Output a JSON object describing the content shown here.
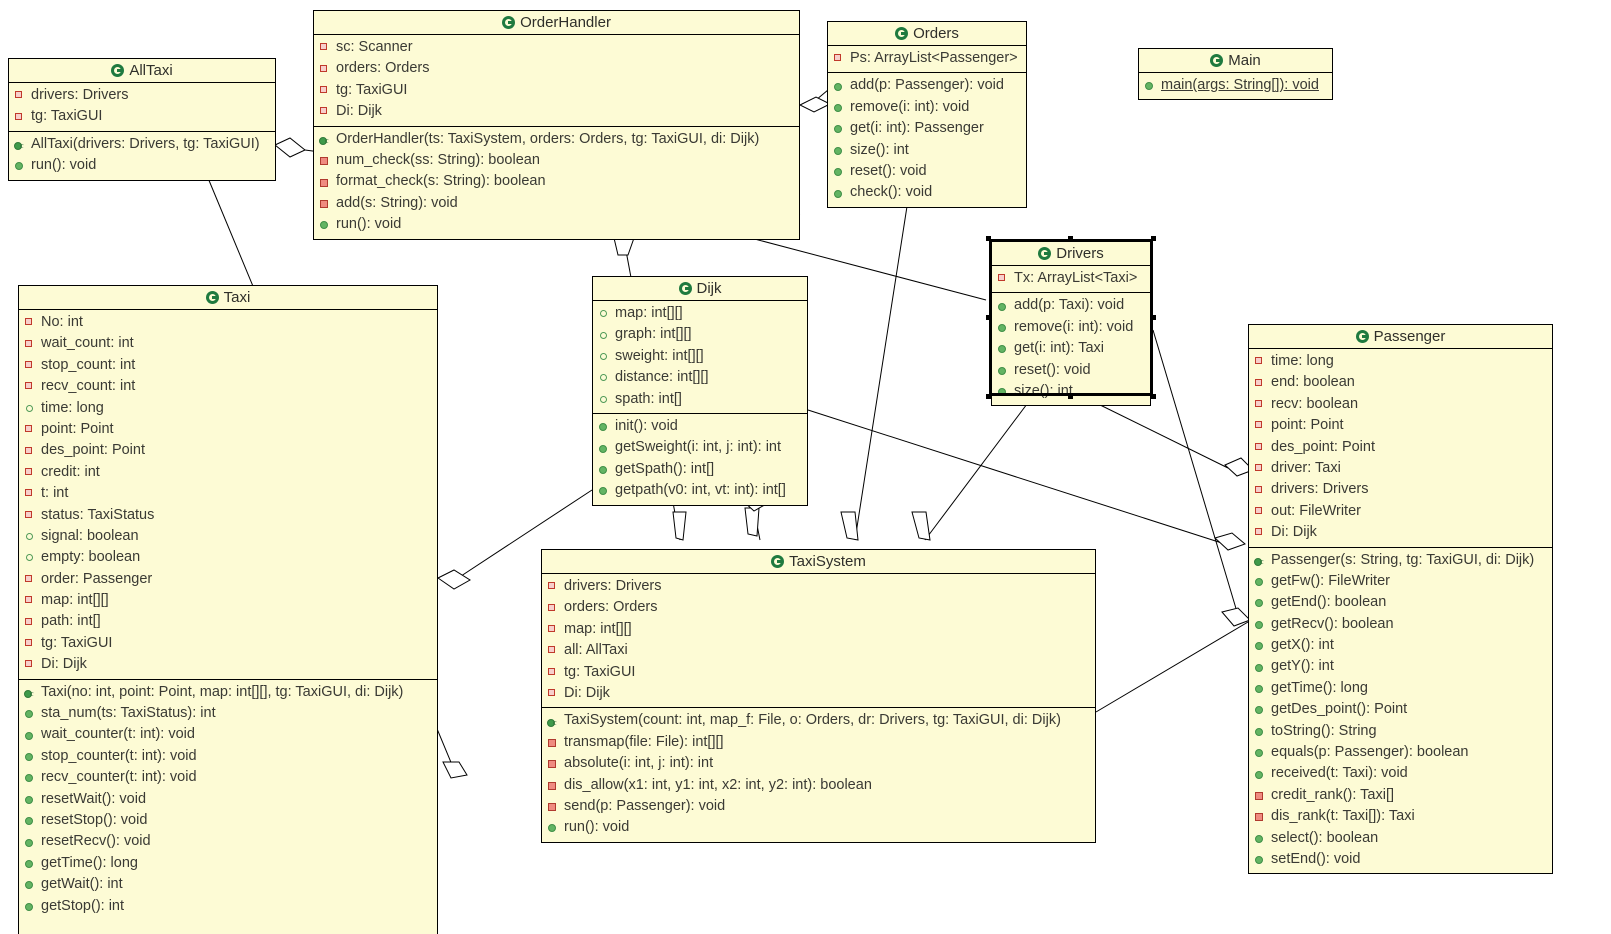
{
  "diagram": {
    "type": "uml-class-diagram",
    "background": "#ffffff",
    "class_fill": "#fdfbd5",
    "border_color": "#000000",
    "icon_color": "#1f7a3f",
    "private_marker_color": "#c0392b",
    "public_marker_color": "#63b463"
  },
  "classes": [
    {
      "id": "alltaxi",
      "name": "AllTaxi",
      "attributes": [
        {
          "text": "drivers: Drivers",
          "vis": "priv"
        },
        {
          "text": "tg: TaxiGUI",
          "vis": "priv"
        }
      ],
      "operations": [
        {
          "text": "AllTaxi(drivers: Drivers, tg: TaxiGUI)",
          "vis": "ctor"
        },
        {
          "text": "run(): void",
          "vis": "pub"
        }
      ]
    },
    {
      "id": "orderhandler",
      "name": "OrderHandler",
      "attributes": [
        {
          "text": "sc: Scanner",
          "vis": "priv"
        },
        {
          "text": "orders: Orders",
          "vis": "priv"
        },
        {
          "text": "tg: TaxiGUI",
          "vis": "priv"
        },
        {
          "text": "Di: Dijk",
          "vis": "priv"
        }
      ],
      "operations": [
        {
          "text": "OrderHandler(ts: TaxiSystem, orders: Orders, tg: TaxiGUI, di: Dijk)",
          "vis": "ctor"
        },
        {
          "text": "num_check(ss: String): boolean",
          "vis": "privm"
        },
        {
          "text": "format_check(s: String): boolean",
          "vis": "privm"
        },
        {
          "text": "add(s: String): void",
          "vis": "privm"
        },
        {
          "text": "run(): void",
          "vis": "pub"
        }
      ]
    },
    {
      "id": "orders",
      "name": "Orders",
      "attributes": [
        {
          "text": "Ps: ArrayList<Passenger>",
          "vis": "priv"
        }
      ],
      "operations": [
        {
          "text": "add(p: Passenger): void",
          "vis": "pub"
        },
        {
          "text": "remove(i: int): void",
          "vis": "pub"
        },
        {
          "text": "get(i: int): Passenger",
          "vis": "pub"
        },
        {
          "text": "size(): int",
          "vis": "pub"
        },
        {
          "text": "reset(): void",
          "vis": "pub"
        },
        {
          "text": "check(): void",
          "vis": "pub"
        }
      ]
    },
    {
      "id": "main",
      "name": "Main",
      "attributes": [],
      "operations": [
        {
          "text": "main(args: String[]): void",
          "vis": "pub",
          "static": true
        }
      ]
    },
    {
      "id": "drivers",
      "name": "Drivers",
      "selected": true,
      "attributes": [
        {
          "text": "Tx: ArrayList<Taxi>",
          "vis": "priv"
        }
      ],
      "operations": [
        {
          "text": "add(p: Taxi): void",
          "vis": "pub"
        },
        {
          "text": "remove(i: int): void",
          "vis": "pub"
        },
        {
          "text": "get(i: int): Taxi",
          "vis": "pub"
        },
        {
          "text": "reset(): void",
          "vis": "pub"
        },
        {
          "text": "size(): int",
          "vis": "pub"
        }
      ]
    },
    {
      "id": "dijk",
      "name": "Dijk",
      "attributes": [
        {
          "text": "map: int[][]",
          "vis": "pkg"
        },
        {
          "text": "graph: int[][]",
          "vis": "pkg"
        },
        {
          "text": "sweight: int[][]",
          "vis": "pkg"
        },
        {
          "text": "distance: int[][]",
          "vis": "pkg"
        },
        {
          "text": "spath: int[]",
          "vis": "pkg"
        }
      ],
      "operations": [
        {
          "text": "init(): void",
          "vis": "pub"
        },
        {
          "text": "getSweight(i: int, j: int): int",
          "vis": "pub"
        },
        {
          "text": "getSpath(): int[]",
          "vis": "pub"
        },
        {
          "text": "getpath(v0: int, vt: int): int[]",
          "vis": "pub"
        }
      ]
    },
    {
      "id": "taxi",
      "name": "Taxi",
      "attributes": [
        {
          "text": "No: int",
          "vis": "priv"
        },
        {
          "text": "wait_count: int",
          "vis": "priv"
        },
        {
          "text": "stop_count: int",
          "vis": "priv"
        },
        {
          "text": "recv_count: int",
          "vis": "priv"
        },
        {
          "text": "time: long",
          "vis": "pkg"
        },
        {
          "text": "point: Point",
          "vis": "priv"
        },
        {
          "text": "des_point: Point",
          "vis": "priv"
        },
        {
          "text": "credit: int",
          "vis": "priv"
        },
        {
          "text": "t: int",
          "vis": "priv"
        },
        {
          "text": "status: TaxiStatus",
          "vis": "priv"
        },
        {
          "text": "signal: boolean",
          "vis": "pkg"
        },
        {
          "text": "empty: boolean",
          "vis": "pkg"
        },
        {
          "text": "order: Passenger",
          "vis": "priv"
        },
        {
          "text": "map: int[][]",
          "vis": "priv"
        },
        {
          "text": "path: int[]",
          "vis": "priv"
        },
        {
          "text": "tg: TaxiGUI",
          "vis": "priv"
        },
        {
          "text": "Di: Dijk",
          "vis": "priv"
        }
      ],
      "operations": [
        {
          "text": "Taxi(no: int, point: Point, map: int[][], tg: TaxiGUI, di: Dijk)",
          "vis": "ctor"
        },
        {
          "text": "sta_num(ts: TaxiStatus): int",
          "vis": "pub"
        },
        {
          "text": "wait_counter(t: int): void",
          "vis": "pub"
        },
        {
          "text": "stop_counter(t: int): void",
          "vis": "pub"
        },
        {
          "text": "recv_counter(t: int): void",
          "vis": "pub"
        },
        {
          "text": "resetWait(): void",
          "vis": "pub"
        },
        {
          "text": "resetStop(): void",
          "vis": "pub"
        },
        {
          "text": "resetRecv(): void",
          "vis": "pub"
        },
        {
          "text": "getTime(): long",
          "vis": "pub"
        },
        {
          "text": "getWait(): int",
          "vis": "pub"
        },
        {
          "text": "getStop(): int",
          "vis": "pub"
        }
      ]
    },
    {
      "id": "taxisystem",
      "name": "TaxiSystem",
      "attributes": [
        {
          "text": "drivers: Drivers",
          "vis": "priv"
        },
        {
          "text": "orders: Orders",
          "vis": "priv"
        },
        {
          "text": "map: int[][]",
          "vis": "priv"
        },
        {
          "text": "all: AllTaxi",
          "vis": "priv"
        },
        {
          "text": "tg: TaxiGUI",
          "vis": "priv"
        },
        {
          "text": "Di: Dijk",
          "vis": "priv"
        }
      ],
      "operations": [
        {
          "text": "TaxiSystem(count: int, map_f: File, o: Orders, dr: Drivers, tg: TaxiGUI, di: Dijk)",
          "vis": "ctor"
        },
        {
          "text": "transmap(file: File): int[][]",
          "vis": "privm"
        },
        {
          "text": "absolute(i: int, j: int): int",
          "vis": "privm"
        },
        {
          "text": "dis_allow(x1: int, y1: int, x2: int, y2: int): boolean",
          "vis": "privm"
        },
        {
          "text": "send(p: Passenger): void",
          "vis": "privm"
        },
        {
          "text": "run(): void",
          "vis": "pub"
        }
      ]
    },
    {
      "id": "passenger",
      "name": "Passenger",
      "attributes": [
        {
          "text": "time: long",
          "vis": "priv"
        },
        {
          "text": "end: boolean",
          "vis": "priv"
        },
        {
          "text": "recv: boolean",
          "vis": "priv"
        },
        {
          "text": "point: Point",
          "vis": "priv"
        },
        {
          "text": "des_point: Point",
          "vis": "priv"
        },
        {
          "text": "driver: Taxi",
          "vis": "priv"
        },
        {
          "text": "drivers: Drivers",
          "vis": "priv"
        },
        {
          "text": "out: FileWriter",
          "vis": "priv"
        },
        {
          "text": "Di: Dijk",
          "vis": "priv"
        }
      ],
      "operations": [
        {
          "text": "Passenger(s: String, tg: TaxiGUI, di: Dijk)",
          "vis": "ctor"
        },
        {
          "text": "getFw(): FileWriter",
          "vis": "pub"
        },
        {
          "text": "getEnd(): boolean",
          "vis": "pub"
        },
        {
          "text": "getRecv(): boolean",
          "vis": "pub"
        },
        {
          "text": "getX(): int",
          "vis": "pub"
        },
        {
          "text": "getY(): int",
          "vis": "pub"
        },
        {
          "text": "getTime(): long",
          "vis": "pub"
        },
        {
          "text": "getDes_point(): Point",
          "vis": "pub"
        },
        {
          "text": "toString(): String",
          "vis": "pub"
        },
        {
          "text": "equals(p: Passenger): boolean",
          "vis": "pub"
        },
        {
          "text": "received(t: Taxi): void",
          "vis": "pub"
        },
        {
          "text": "credit_rank(): Taxi[]",
          "vis": "privm"
        },
        {
          "text": "dis_rank(t: Taxi[]): Taxi",
          "vis": "privm"
        },
        {
          "text": "select(): boolean",
          "vis": "pub"
        },
        {
          "text": "setEnd(): void",
          "vis": "pub"
        }
      ]
    }
  ]
}
